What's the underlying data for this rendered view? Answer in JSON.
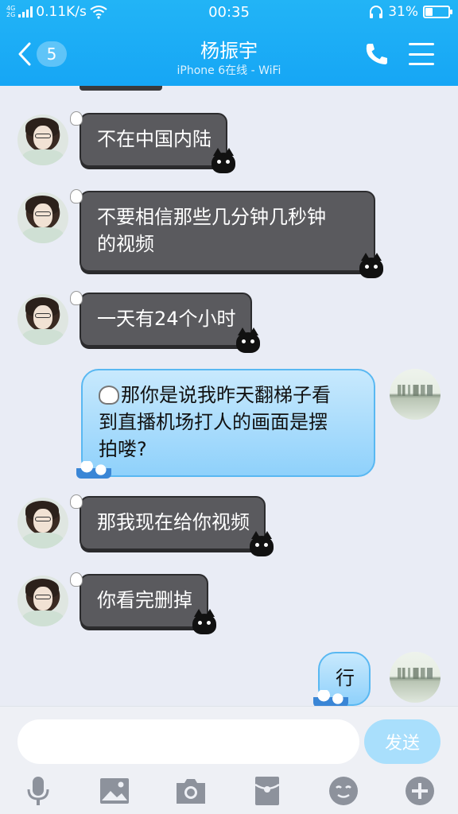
{
  "status_bar": {
    "network_tag_top": "4G",
    "network_tag_bottom": "2G",
    "speed": "0.11K/s",
    "time": "00:35",
    "battery_percent": "31%",
    "battery_level": 0.31
  },
  "header": {
    "back_badge": "5",
    "title": "杨振宇",
    "subtitle": "iPhone 6在线 - WiFi",
    "icons": [
      "back-chevron-icon",
      "phone-icon",
      "menu-icon"
    ]
  },
  "messages": [
    {
      "side": "left",
      "text": "不在中国内陆"
    },
    {
      "side": "left",
      "lines": [
        "不要相信那些几分钟几秒钟",
        "的视频"
      ]
    },
    {
      "side": "left",
      "text": "一天有24个小时"
    },
    {
      "side": "right",
      "lines": [
        "那你是说我昨天翻梯子看",
        "到直播机场打人的画面是摆",
        "拍喽?"
      ]
    },
    {
      "side": "left",
      "text": "那我现在给你视频"
    },
    {
      "side": "left",
      "text": "你看完删掉"
    },
    {
      "side": "right",
      "text": "行"
    }
  ],
  "input_bar": {
    "placeholder": "",
    "send_label": "发送",
    "tool_icons": [
      "microphone-icon",
      "image-icon",
      "camera-icon",
      "red-envelope-icon",
      "emoji-icon",
      "plus-icon"
    ]
  },
  "colors": {
    "header": "#1aaaf5",
    "chat_background": "#e9ecf5",
    "dark_bubble": "#5a5a5e",
    "blue_bubble": "#a8dcfb",
    "send_button": "#a9dffc"
  }
}
